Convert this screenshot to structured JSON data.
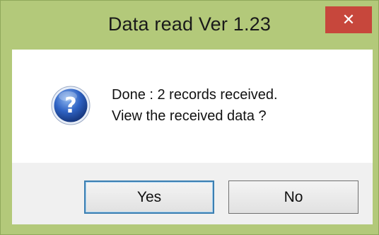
{
  "window": {
    "title": "Data read  Ver 1.23",
    "close_symbol": "✕",
    "frame_color": "#b3c97a",
    "close_color": "#c7473c"
  },
  "message": {
    "icon": "question-icon",
    "line1": "Done : 2 records received.",
    "line2": "View the received data ?"
  },
  "buttons": {
    "yes_label": "Yes",
    "no_label": "No",
    "default": "yes"
  }
}
